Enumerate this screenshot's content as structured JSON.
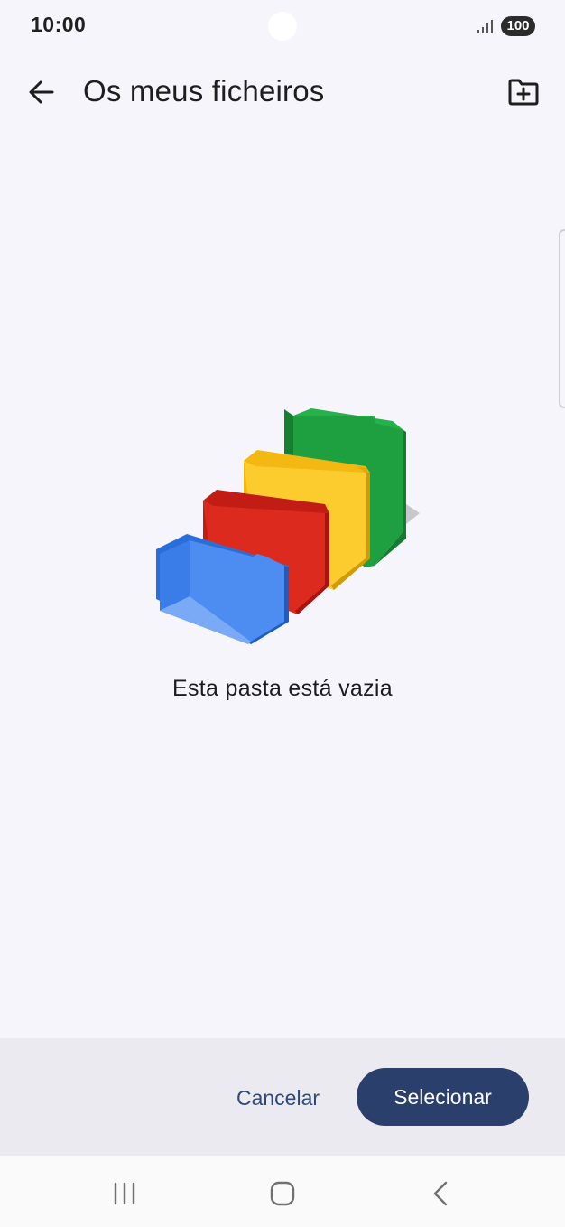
{
  "status_bar": {
    "time": "10:00",
    "battery": "100",
    "icons": [
      "camera-hole",
      "signal-icon",
      "battery-icon"
    ]
  },
  "app_bar": {
    "title": "Os meus ficheiros",
    "back_icon": "arrow-left-icon",
    "action_icon": "new-folder-icon"
  },
  "empty_state": {
    "message": "Esta pasta está vazia",
    "illustration": "colored-folders-illustration",
    "colors": [
      "#3b7de8",
      "#dd2a1f",
      "#fccc2e",
      "#1fa040"
    ]
  },
  "actions": {
    "cancel_label": "Cancelar",
    "select_label": "Selecionar"
  },
  "nav_bar": {
    "icons": [
      "recent-apps-icon",
      "home-icon",
      "back-icon"
    ]
  },
  "colors": {
    "background": "#f6f5fb",
    "action_bar": "#ebeaf0",
    "primary": "#2b3f6c",
    "text_button": "#2f4a7a"
  }
}
